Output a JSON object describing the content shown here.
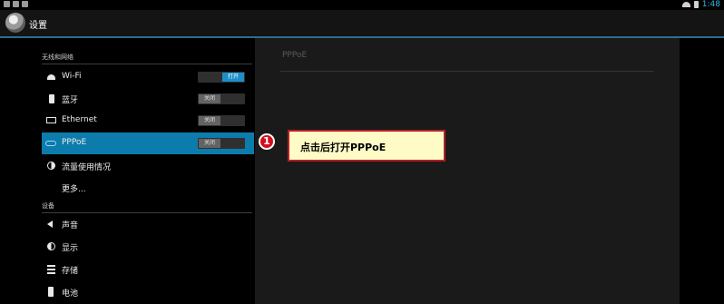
{
  "status_bar": {
    "time": "1:48"
  },
  "action_bar": {
    "title": "设置",
    "app_icon": "settings-app-icon"
  },
  "sections": [
    {
      "header": "无线和网络",
      "items": [
        {
          "label": "Wi-Fi",
          "icon": "wifi-icon",
          "toggle": "打开"
        },
        {
          "label": "蓝牙",
          "icon": "bluetooth-icon",
          "toggle": "关闭"
        },
        {
          "label": "Ethernet",
          "icon": "ethernet-icon",
          "toggle": "关闭"
        },
        {
          "label": "PPPoE",
          "icon": "pppoe-icon",
          "toggle": "关闭",
          "selected": true
        },
        {
          "label": "流量使用情况",
          "icon": "data-usage-icon"
        },
        {
          "label": "更多..."
        }
      ]
    },
    {
      "header": "设备",
      "items": [
        {
          "label": "声音",
          "icon": "sound-icon"
        },
        {
          "label": "显示",
          "icon": "display-icon"
        },
        {
          "label": "存储",
          "icon": "storage-icon"
        },
        {
          "label": "电池",
          "icon": "battery-icon"
        }
      ]
    }
  ],
  "detail_pane": {
    "header": "PPPoE"
  },
  "annotation": {
    "number": "1",
    "text": "点击后打开PPPoE"
  },
  "colors": {
    "accent": "#0c7cad",
    "callout_fill": "#fffbc6",
    "callout_border": "#b41f28"
  }
}
